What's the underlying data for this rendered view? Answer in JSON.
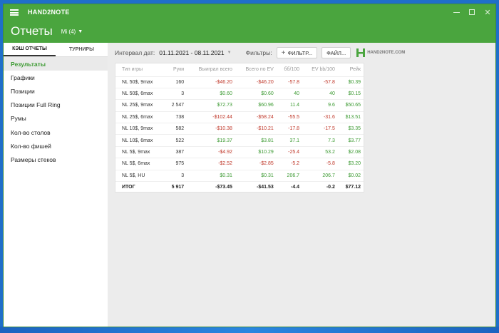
{
  "app": {
    "title": "HAND2NOTE"
  },
  "header": {
    "page_title": "Отчеты",
    "player": "Mi (4)"
  },
  "sidebar": {
    "tabs": [
      {
        "label": "КЭШ ОТЧЕТЫ"
      },
      {
        "label": "ТУРНИРЫ"
      }
    ],
    "items": [
      {
        "label": "Результаты"
      },
      {
        "label": "Графики"
      },
      {
        "label": "Позиции"
      },
      {
        "label": "Позиции Full Ring"
      },
      {
        "label": "Румы"
      },
      {
        "label": "Кол-во столов"
      },
      {
        "label": "Кол-во фишей"
      },
      {
        "label": "Размеры стеков"
      }
    ]
  },
  "filterbar": {
    "interval_label": "Интервал дат:",
    "date_range": "01.11.2021 - 08.11.2021",
    "filters_label": "Фильтры:",
    "filter_button": "ФИЛЬТР...",
    "file_button": "ФАЙЛ...",
    "logo_text": "HAND2NOTE.COM"
  },
  "table": {
    "headers": [
      "Тип игры",
      "Руки",
      "Выиграл всего",
      "Всего по EV",
      "бб/100",
      "EV bb/100",
      "Рейк"
    ],
    "rows": [
      [
        "NL 50$, 9max",
        "160",
        "-$46.20",
        "-$46.20",
        "-57.8",
        "-57.8",
        "$0.39"
      ],
      [
        "NL 50$, 6max",
        "3",
        "$0.60",
        "$0.60",
        "40",
        "40",
        "$0.15"
      ],
      [
        "NL 25$, 9max",
        "2 547",
        "$72.73",
        "$60.96",
        "11.4",
        "9.6",
        "$50.65"
      ],
      [
        "NL 25$, 6max",
        "738",
        "-$102.44",
        "-$58.24",
        "-55.5",
        "-31.6",
        "$13.51"
      ],
      [
        "NL 10$, 9max",
        "582",
        "-$10.38",
        "-$10.21",
        "-17.8",
        "-17.5",
        "$3.35"
      ],
      [
        "NL 10$, 6max",
        "522",
        "$19.37",
        "$3.81",
        "37.1",
        "7.3",
        "$3.77"
      ],
      [
        "NL 5$, 9max",
        "387",
        "-$4.92",
        "$10.29",
        "-25.4",
        "53.2",
        "$2.08"
      ],
      [
        "NL 5$, 6max",
        "975",
        "-$2.52",
        "-$2.85",
        "-5.2",
        "-5.8",
        "$3.20"
      ],
      [
        "NL 5$, HU",
        "3",
        "$0.31",
        "$0.31",
        "206.7",
        "206.7",
        "$0.02"
      ]
    ],
    "total": [
      "ИТОГ",
      "5 917",
      "-$73.45",
      "-$41.53",
      "-4.4",
      "-0.2",
      "$77.12"
    ]
  },
  "colors": {
    "brand_green": "#4aa53e",
    "positive": "#3c9a32",
    "negative": "#c0392b"
  }
}
